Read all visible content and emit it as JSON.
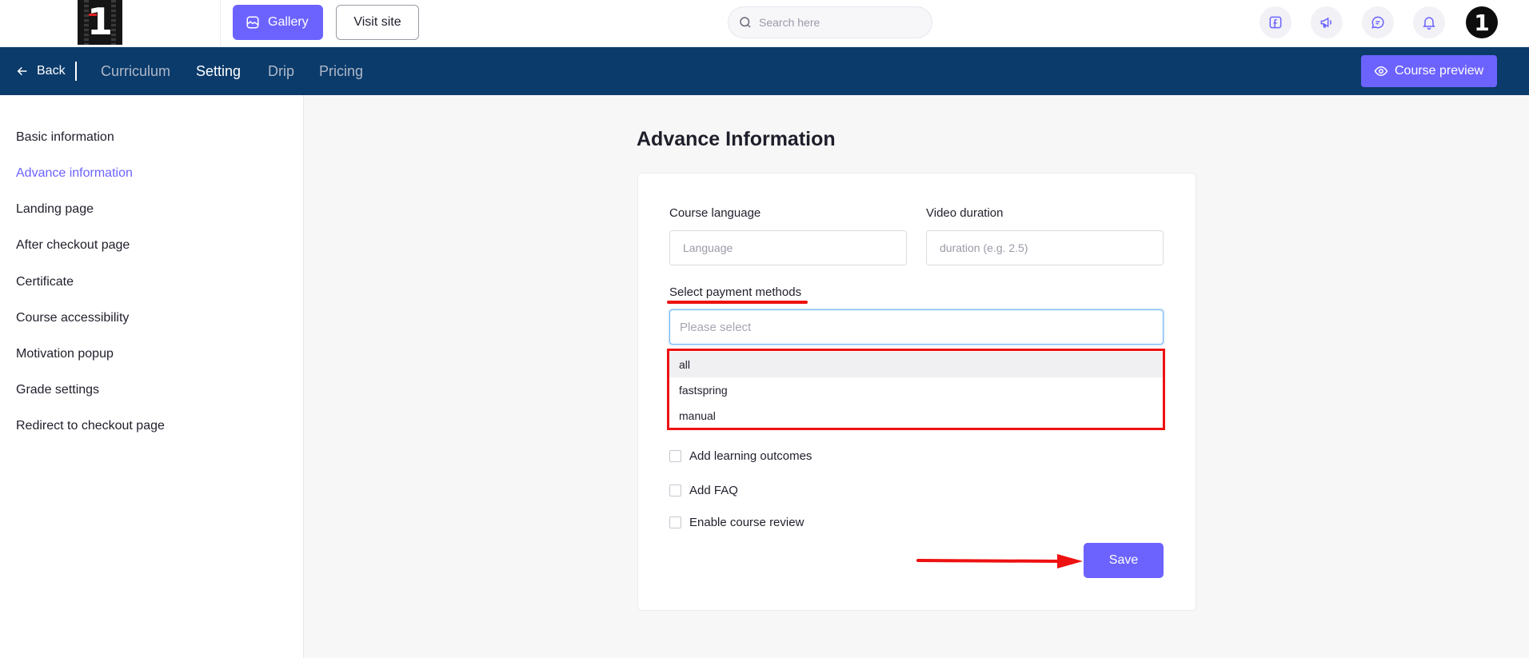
{
  "topbar": {
    "logo_text": "1",
    "gallery_label": "Gallery",
    "visit_site_label": "Visit site",
    "search_placeholder": "Search here",
    "avatar_text": "1"
  },
  "navbar": {
    "back_label": "Back",
    "tabs": [
      {
        "label": "Curriculum"
      },
      {
        "label": "Setting"
      },
      {
        "label": "Drip"
      },
      {
        "label": "Pricing"
      }
    ],
    "active_tab": "Setting",
    "course_preview_label": "Course preview"
  },
  "sidebar": {
    "items": [
      {
        "label": "Basic information"
      },
      {
        "label": "Advance information"
      },
      {
        "label": "Landing page"
      },
      {
        "label": "After checkout page"
      },
      {
        "label": "Certificate"
      },
      {
        "label": "Course accessibility"
      },
      {
        "label": "Motivation popup"
      },
      {
        "label": "Grade settings"
      },
      {
        "label": "Redirect to checkout page"
      }
    ],
    "active_item": "Advance information"
  },
  "main": {
    "title": "Advance Information",
    "course_language": {
      "label": "Course language",
      "placeholder": "Language",
      "value": ""
    },
    "video_duration": {
      "label": "Video duration",
      "placeholder": "duration (e.g. 2.5)",
      "value": ""
    },
    "payment_methods": {
      "label": "Select payment methods",
      "placeholder": "Please select",
      "options": [
        {
          "label": "all"
        },
        {
          "label": "fastspring"
        },
        {
          "label": "manual"
        }
      ],
      "highlighted_option": "all"
    },
    "checkboxes": [
      {
        "label": "Add learning outcomes",
        "checked": false
      },
      {
        "label": "Add FAQ",
        "checked": false
      },
      {
        "label": "Enable course review",
        "checked": false
      }
    ],
    "save_label": "Save"
  },
  "colors": {
    "accent": "#6c63ff",
    "navbar_bg": "#0b3b6b",
    "annotation_red": "#ee1111"
  }
}
